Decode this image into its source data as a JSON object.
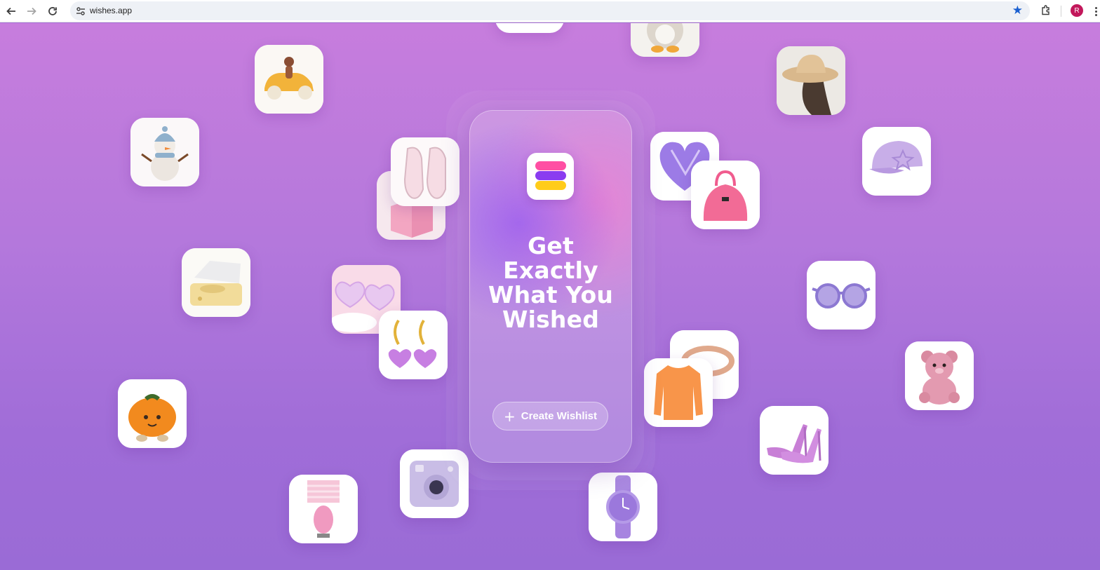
{
  "browser": {
    "url": "wishes.app",
    "profile_initial": "R",
    "back_icon": "arrow-left-icon",
    "forward_icon": "arrow-right-icon",
    "reload_icon": "reload-icon",
    "bookmark_icon": "star-icon",
    "extensions_icon": "puzzle-icon",
    "accent_color": "#1a5fd0"
  },
  "hero": {
    "title_line1": "Get Exactly",
    "title_line2": "What You",
    "title_line3": "Wished",
    "cta_label": "Create Wishlist",
    "cta_icon": "plus-icon",
    "logo_icon": "wishes-logo-icon"
  },
  "theme": {
    "background_top": "#c77ddd",
    "background_bottom": "#9a6bd6",
    "logo_colors": [
      "#ff4fa3",
      "#8a3cf0",
      "#ffcc1a"
    ]
  },
  "products": [
    "toy-car-icon",
    "snowman-plush-icon",
    "record-player-icon",
    "pumpkin-plush-icon",
    "sneakers-icon",
    "pink-cube-icon",
    "heart-sunglasses-icon",
    "heart-earrings-icon",
    "instant-camera-icon",
    "table-lamp-icon",
    "wristwatch-icon",
    "orange-sweater-icon",
    "ring-icon",
    "heart-ornament-icon",
    "handbag-icon",
    "straw-hat-icon",
    "baseball-cap-icon",
    "round-sunglasses-icon",
    "teddy-bear-icon",
    "heels-icon",
    "penguin-plush-icon"
  ]
}
